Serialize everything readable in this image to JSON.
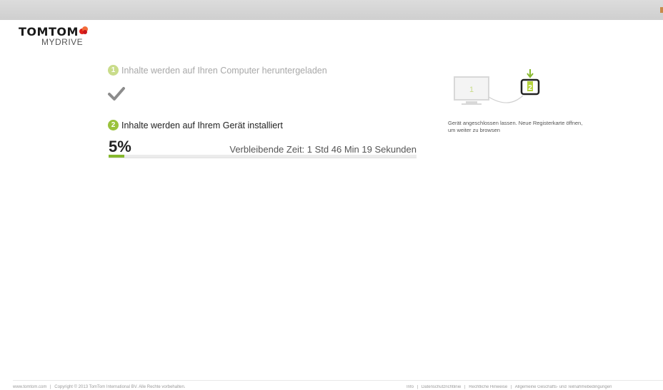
{
  "brand": {
    "name": "TOMTOM",
    "product": "MYDRIVE"
  },
  "steps": [
    {
      "number": "1",
      "label": "Inhalte werden auf Ihren Computer heruntergeladen",
      "status": "complete"
    },
    {
      "number": "2",
      "label": "Inhalte werden auf Ihrem Gerät installiert",
      "status": "in-progress"
    }
  ],
  "progress": {
    "percent_label": "5%",
    "value": 5,
    "remaining_label": "Verbleibende Zeit: 1 Std 46 Min 19 Sekunden"
  },
  "illustration": {
    "computer_number": "1",
    "device_number": "2",
    "caption": "Gerät angeschlossen lassen. Neue Registerkarte öffnen, um weiter zu browsen"
  },
  "footer": {
    "left": [
      "www.tomtom.com",
      "|",
      "Copyright © 2013 TomTom International BV. Alle Rechte vorbehalten."
    ],
    "right": [
      "Info",
      "|",
      "Datenschutzrichtlinie",
      "|",
      "Rechtliche Hinweise",
      "|",
      "Allgemeine Geschäfts- und Teilnahmebedingungen"
    ]
  },
  "colors": {
    "accent_green": "#86b82d",
    "step1_badge": "#c9dc8a",
    "brand_red": "#e2231a"
  }
}
